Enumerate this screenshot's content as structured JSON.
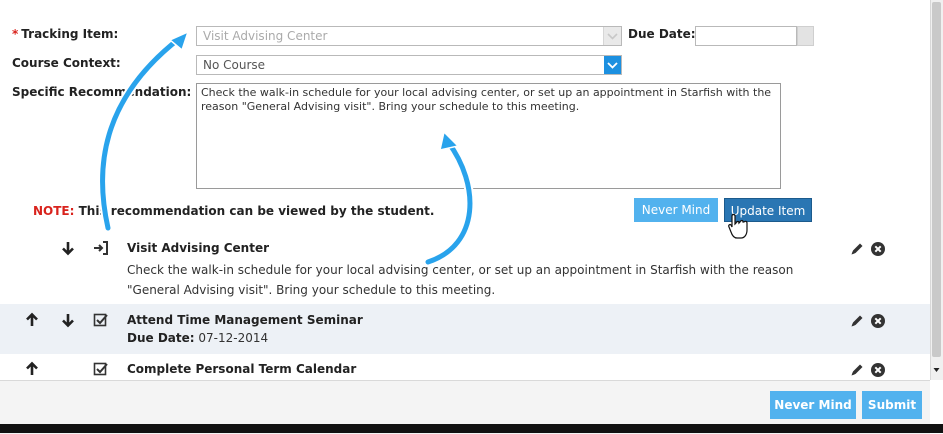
{
  "form": {
    "tracking_item_label": "Tracking Item:",
    "tracking_item_value": "Visit Advising Center",
    "due_date_label": "Due Date:",
    "due_date_value": "",
    "course_context_label": "Course Context:",
    "course_context_value": "No Course",
    "recommendation_label": "Specific Recommendation:",
    "recommendation_text": "Check the walk-in schedule for your local advising center, or set up an appointment in Starfish with the reason \"General Advising visit\". Bring your schedule to this meeting.",
    "note_label": "NOTE:",
    "note_text": " This recommendation can be viewed by the student.",
    "never_mind_label": "Never Mind",
    "update_item_label": "Update Item"
  },
  "items": [
    {
      "title": "Visit Advising Center",
      "description": "Check the walk-in schedule for your local advising center, or set up an appointment in Starfish with the reason \"General Advising visit\". Bring your schedule to this meeting.",
      "type_icon": "sign-in-icon"
    },
    {
      "title": "Attend Time Management Seminar",
      "due_label": "Due Date:",
      "due_value": " 07-12-2014",
      "type_icon": "checkbox-icon"
    },
    {
      "title": "Complete Personal Term Calendar",
      "type_icon": "checkbox-icon"
    }
  ],
  "footer": {
    "never_mind_label": "Never Mind",
    "submit_label": "Submit"
  },
  "colors": {
    "accent_blue": "#1c90e0",
    "button_light": "#52b2ee",
    "button_dark": "#2a76b3",
    "required_red": "#d9231d",
    "annotation_arrow": "#29a3ec"
  }
}
